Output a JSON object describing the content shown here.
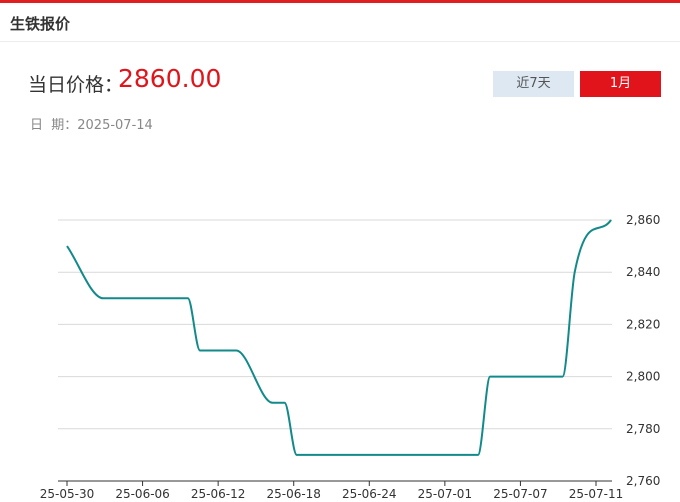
{
  "header": {
    "title": "生铁报价"
  },
  "price": {
    "label": "当日价格：",
    "value": "2860.00"
  },
  "date": {
    "label": "日  期：",
    "value": "2025-07-14"
  },
  "tabs": [
    {
      "label": "近7天",
      "active": false
    },
    {
      "label": "1月",
      "active": true
    }
  ],
  "colors": {
    "accent": "#e0141a",
    "line": "#138a8a",
    "tab_inactive": "#dde8f3"
  },
  "chart_data": {
    "type": "line",
    "x_ticks": [
      "25-05-30",
      "25-06-06",
      "25-06-12",
      "25-06-18",
      "25-06-24",
      "25-07-01",
      "25-07-07",
      "25-07-11"
    ],
    "y_ticks": [
      2760,
      2780,
      2800,
      2820,
      2840,
      2860
    ],
    "ylim": [
      2760,
      2860
    ],
    "grid": true,
    "series": [
      {
        "points": [
          [
            "2025-05-30",
            2850
          ],
          [
            "2025-06-02",
            2830
          ],
          [
            "2025-06-03",
            2830
          ],
          [
            "2025-06-04",
            2830
          ],
          [
            "2025-06-05",
            2830
          ],
          [
            "2025-06-06",
            2830
          ],
          [
            "2025-06-09",
            2830
          ],
          [
            "2025-06-10",
            2810
          ],
          [
            "2025-06-11",
            2810
          ],
          [
            "2025-06-12",
            2810
          ],
          [
            "2025-06-13",
            2810
          ],
          [
            "2025-06-16",
            2790
          ],
          [
            "2025-06-17",
            2790
          ],
          [
            "2025-06-18",
            2770
          ],
          [
            "2025-06-19",
            2770
          ],
          [
            "2025-06-20",
            2770
          ],
          [
            "2025-06-23",
            2770
          ],
          [
            "2025-06-24",
            2770
          ],
          [
            "2025-06-25",
            2770
          ],
          [
            "2025-06-26",
            2770
          ],
          [
            "2025-06-27",
            2770
          ],
          [
            "2025-06-30",
            2770
          ],
          [
            "2025-07-01",
            2770
          ],
          [
            "2025-07-02",
            2770
          ],
          [
            "2025-07-03",
            2770
          ],
          [
            "2025-07-04",
            2800
          ],
          [
            "2025-07-07",
            2800
          ],
          [
            "2025-07-08",
            2800
          ],
          [
            "2025-07-09",
            2800
          ],
          [
            "2025-07-10",
            2800
          ],
          [
            "2025-07-11",
            2840
          ],
          [
            "2025-07-14",
            2860
          ]
        ]
      }
    ]
  }
}
